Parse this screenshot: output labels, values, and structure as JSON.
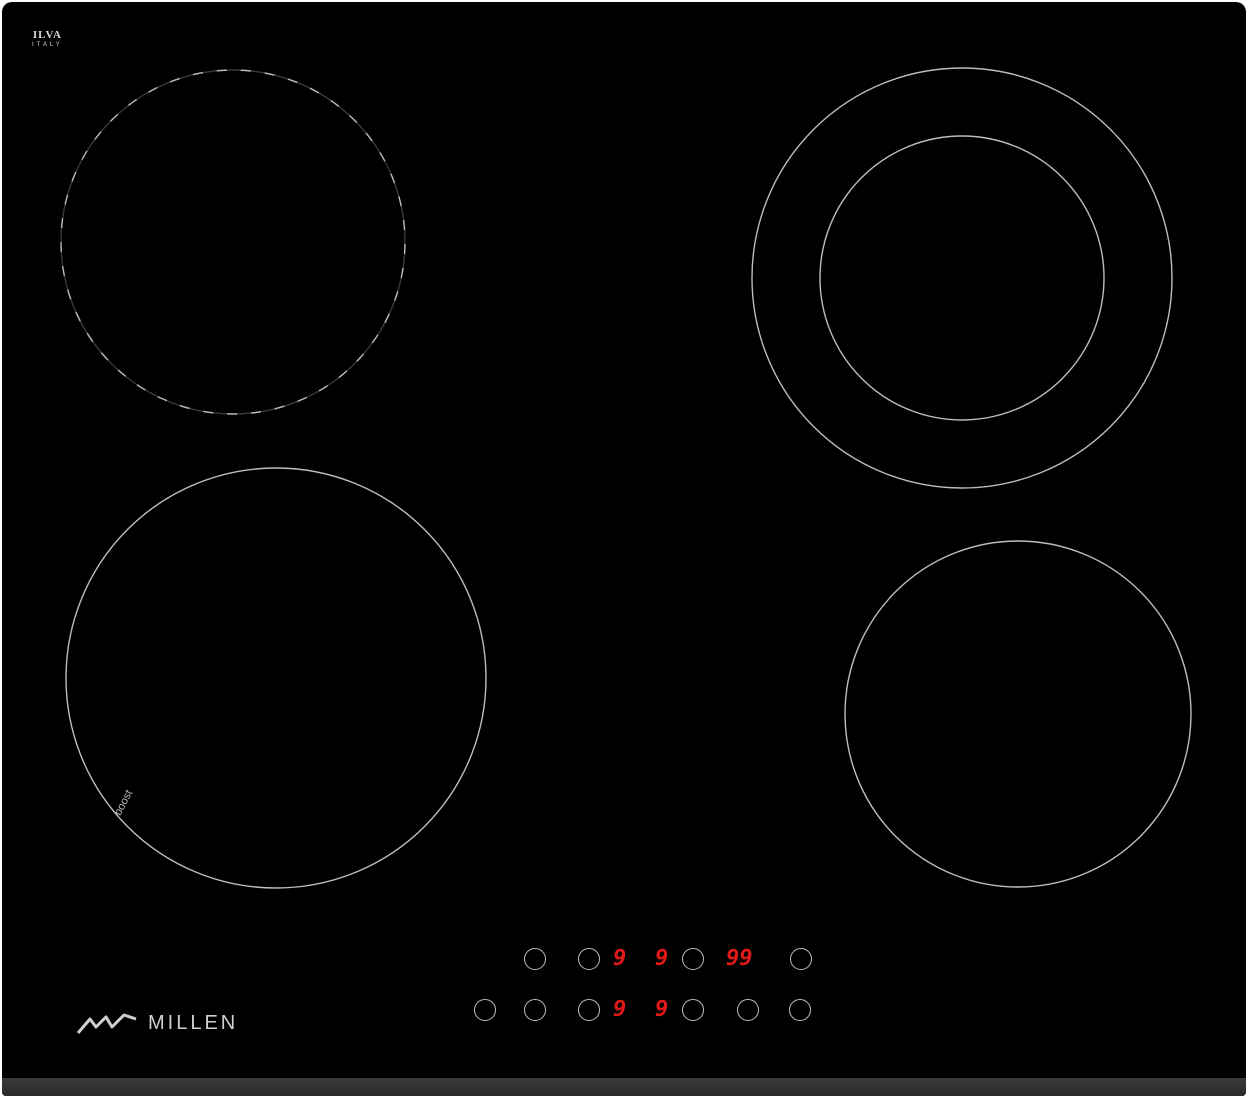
{
  "brand_top": {
    "mark": "ILVA",
    "sub": "ITALY"
  },
  "zone_label": "boost",
  "logo": {
    "name": "MILLEN"
  },
  "display": {
    "top_left_digit": "9",
    "top_right_digit": "9",
    "timer_digits": "99",
    "bottom_left_digit": "9",
    "bottom_right_digit": "9"
  },
  "icons": {
    "lock": "lock-icon",
    "power": "power-icon",
    "timer": "timer-icon",
    "minus": "minus-icon",
    "plus": "plus-icon",
    "zone_select": "zone-select-icon"
  },
  "colors": {
    "glass": "#000000",
    "digits": "#e01818",
    "lines": "#bdbdbd"
  }
}
